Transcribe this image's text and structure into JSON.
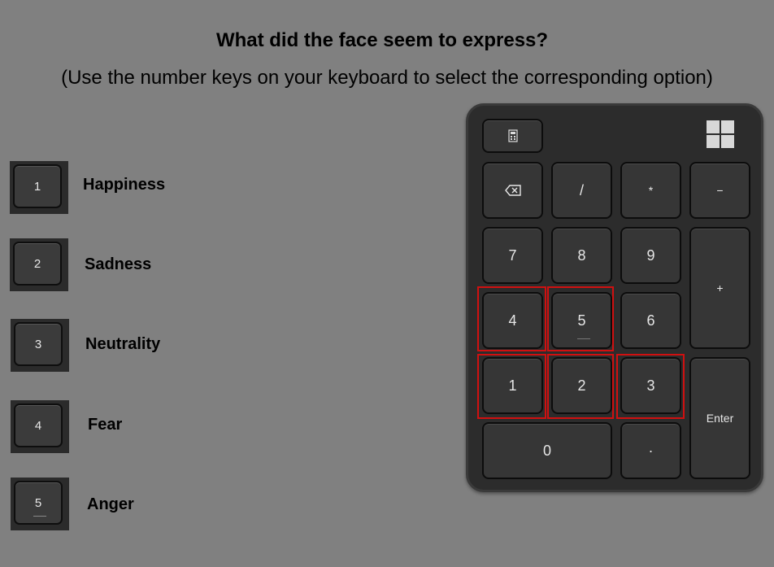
{
  "question": "What did the face seem to express?",
  "instruction": "(Use the number keys on your keyboard to select the corresponding option)",
  "options": [
    {
      "key": "1",
      "label": "Happiness"
    },
    {
      "key": "2",
      "label": "Sadness"
    },
    {
      "key": "3",
      "label": "Neutrality"
    },
    {
      "key": "4",
      "label": "Fear"
    },
    {
      "key": "5",
      "label": "Anger"
    }
  ],
  "keypad": {
    "slash": "/",
    "asterisk": "*",
    "minus": "−",
    "k7": "7",
    "k8": "8",
    "k9": "9",
    "plus": "+",
    "k4": "4",
    "k5": "5",
    "k6": "6",
    "k1": "1",
    "k2": "2",
    "k3": "3",
    "enter": "Enter",
    "k0": "0",
    "dot": "·",
    "highlight_color": "#d01010"
  }
}
